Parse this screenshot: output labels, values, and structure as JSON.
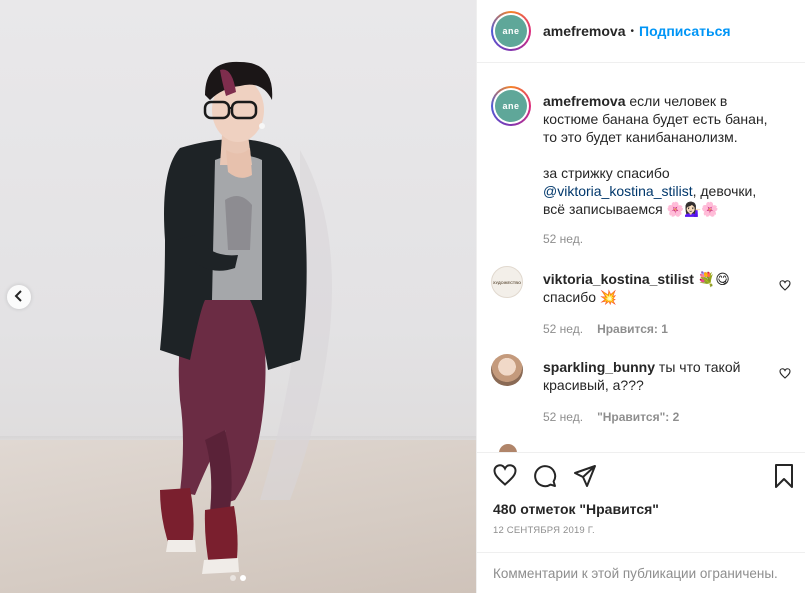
{
  "post": {
    "username": "amefremova",
    "follow_label": "Подписаться",
    "avatar_text": "ane",
    "caption_line1": "если человек в костюме банана будет есть банан, то это будет канибананолизм.",
    "caption_line2_prefix": "за стрижку спасибо",
    "caption_mention": "@viktoria_kostina_stilist",
    "caption_line2_suffix": ", девочки, всё записываемся 🌸💁🏻‍♀️🌸",
    "caption_time": "52 нед.",
    "likes_text": "480 отметок \"Нравится\"",
    "date_text": "12 СЕНТЯБРЯ 2019 Г.",
    "restricted_text": "Комментарии к этой публикации ограничены."
  },
  "comments": [
    {
      "username": "viktoria_kostina_stilist",
      "emoji": "💐😋",
      "text": "спасибо 💥",
      "time": "52 нед.",
      "likes": "Нравится: 1",
      "avatar_text": "ХУДОЖЕСТВО"
    },
    {
      "username": "sparkling_bunny",
      "text": "ты что такой красивый, а???",
      "time": "52 нед.",
      "likes": "\"Нравится\": 2"
    }
  ],
  "icons": {
    "carousel_prev": "chevron-left-icon",
    "like": "heart-icon",
    "comment": "comment-bubble-icon",
    "share": "paper-plane-icon",
    "save": "bookmark-icon"
  },
  "carousel": {
    "slide_count": 2,
    "active_index": 1
  },
  "colors": {
    "accent": "#0095f6",
    "muted": "#8e8e8e",
    "text": "#262626",
    "mention": "#00376b",
    "avatar_green": "#5fa799"
  }
}
